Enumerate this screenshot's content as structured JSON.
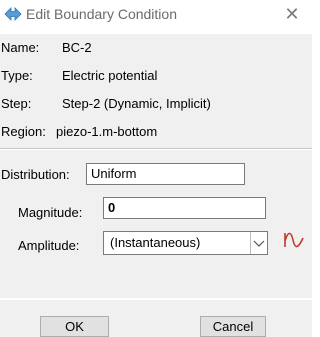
{
  "window": {
    "title": "Edit Boundary Condition",
    "close_glyph": "✕"
  },
  "info": {
    "name_label": "Name:",
    "name_value": "BC-2",
    "type_label": "Type:",
    "type_value": "Electric potential",
    "step_label": "Step:",
    "step_value": "Step-2 (Dynamic, Implicit)",
    "region_label": "Region:",
    "region_value": "piezo-1.m-bottom"
  },
  "form": {
    "distribution_label": "Distribution:",
    "distribution_value": "Uniform",
    "magnitude_label": "Magnitude:",
    "magnitude_value": "0",
    "amplitude_label": "Amplitude:",
    "amplitude_value": "(Instantaneous)",
    "amplitude_icon": "amplitude-curve-icon"
  },
  "buttons": {
    "ok_label": "OK",
    "cancel_label": "Cancel"
  },
  "colors": {
    "accent": "#4a90d9",
    "panel": "#f0f0f0",
    "amplitude_icon": "#c0392b"
  }
}
